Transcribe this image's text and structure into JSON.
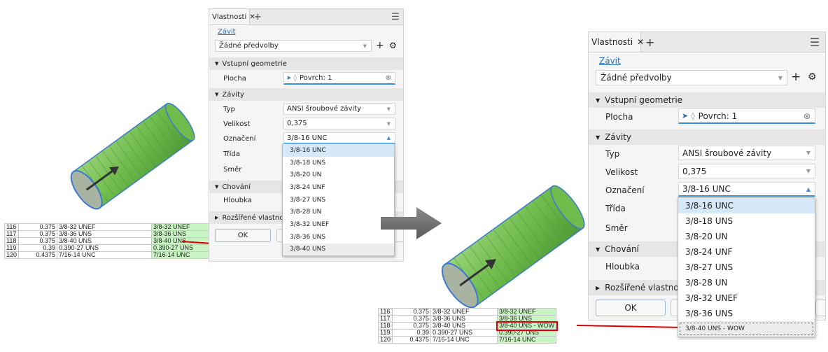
{
  "colors": {
    "accent": "#3b8fd6",
    "link": "#2b6db3",
    "highlight": "#d6e9f8",
    "red_line": "#e00000",
    "green_cell": "#c9f4c3",
    "cylinder": "#7cc35a"
  },
  "left_table": {
    "rows": [
      {
        "id": "116",
        "val": "0.375",
        "name": "3/8-32 UNEF",
        "label": "3/8-32 UNEF"
      },
      {
        "id": "117",
        "val": "0.375",
        "name": "3/8-36 UNS",
        "label": "3/8-36 UNS"
      },
      {
        "id": "118",
        "val": "0.375",
        "name": "3/8-40 UNS",
        "label": "3/8-40 UNS"
      },
      {
        "id": "119",
        "val": "0.39",
        "name": "0.390-27 UNS",
        "label": "0.390-27 UNS"
      },
      {
        "id": "120",
        "val": "0.4375",
        "name": "7/16-14 UNC",
        "label": "7/16-14 UNC"
      }
    ]
  },
  "right_table": {
    "rows": [
      {
        "id": "116",
        "val": "0.375",
        "name": "3/8-32 UNEF",
        "label": "3/8-32 UNEF"
      },
      {
        "id": "117",
        "val": "0.375",
        "name": "3/8-36 UNS",
        "label": "3/8-36 UNS"
      },
      {
        "id": "118",
        "val": "0.375",
        "name": "3/8-40 UNS",
        "label": "3/8-40 UNS - WOW"
      },
      {
        "id": "119",
        "val": "0.39",
        "name": "0.390-27 UNS",
        "label": "0.390-27 UNS"
      },
      {
        "id": "120",
        "val": "0.4375",
        "name": "7/16-14 UNC",
        "label": "7/16-14 UNC"
      }
    ]
  },
  "panel_left": {
    "tab_title": "Vlastnosti",
    "close_glyph": "✕",
    "plus_glyph": "+",
    "menu_glyph": "☰",
    "link": "Závit",
    "preset": "Žádné předvolby",
    "section_input": "Vstupní geometrie",
    "plocha_label": "Plocha",
    "plocha_value": "Povrch: 1",
    "section_threads": "Závity",
    "typ_label": "Typ",
    "typ_value": "ANSI šroubové závity",
    "velikost_label": "Velikost",
    "velikost_value": "0,375",
    "oznaceni_label": "Označení",
    "oznaceni_value": "3/8-16 UNC",
    "trida_label": "Třída",
    "smer_label": "Směr",
    "section_behavior": "Chování",
    "hloubka_label": "Hloubka",
    "section_advanced": "Rozšířené vlastnosti",
    "ok_label": "OK",
    "options": [
      "3/8-16 UNC",
      "3/8-18 UNS",
      "3/8-20 UN",
      "3/8-24 UNF",
      "3/8-27 UNS",
      "3/8-28 UN",
      "3/8-32 UNEF",
      "3/8-36 UNS",
      "3/8-40 UNS"
    ]
  },
  "panel_right": {
    "tab_title": "Vlastnosti",
    "close_glyph": "✕",
    "plus_glyph": "+",
    "menu_glyph": "☰",
    "link": "Závit",
    "preset": "Žádné předvolby",
    "section_input": "Vstupní geometrie",
    "plocha_label": "Plocha",
    "plocha_value": "Povrch: 1",
    "section_threads": "Závity",
    "typ_label": "Typ",
    "typ_value": "ANSI šroubové závity",
    "velikost_label": "Velikost",
    "velikost_value": "0,375",
    "oznaceni_label": "Označení",
    "oznaceni_value": "3/8-16 UNC",
    "trida_label": "Třída",
    "smer_label": "Směr",
    "section_behavior": "Chování",
    "hloubka_label": "Hloubka",
    "section_advanced": "Rozšířené vlastnosti",
    "ok_label": "OK",
    "options": [
      "3/8-16 UNC",
      "3/8-18 UNS",
      "3/8-20 UN",
      "3/8-24 UNF",
      "3/8-27 UNS",
      "3/8-28 UN",
      "3/8-32 UNEF",
      "3/8-36 UNS",
      "3/8-40 UNS - WOW"
    ]
  },
  "icons": {
    "arrow": "right-arrow-icon",
    "cursor": "pointer-icon",
    "face": "face-select-icon",
    "clear": "clear-icon",
    "gear": "gear-icon",
    "menu": "hamburger-menu-icon"
  }
}
